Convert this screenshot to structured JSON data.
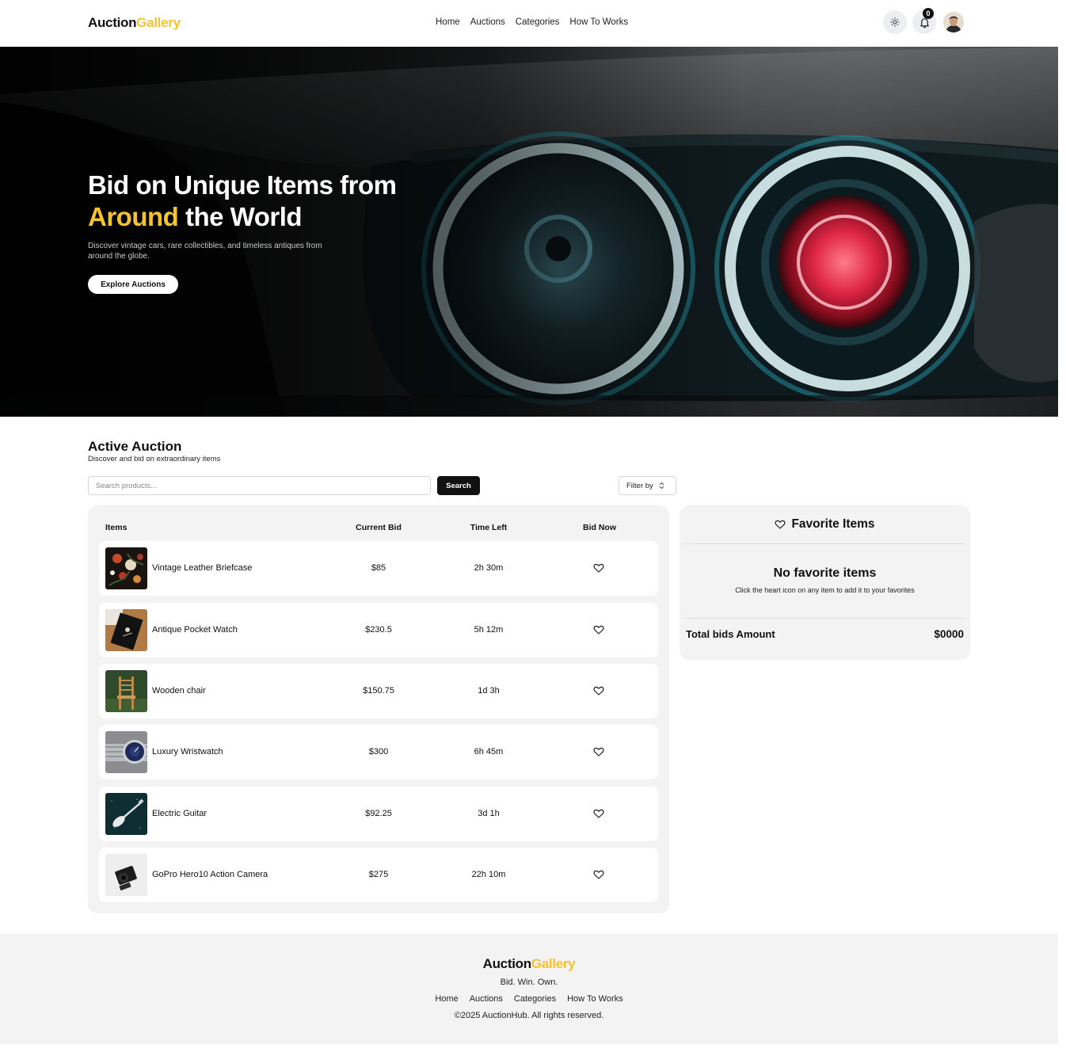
{
  "header": {
    "logo_part1": "Auction",
    "logo_part2": "Gallery",
    "nav": [
      "Home",
      "Auctions",
      "Categories",
      "How To Works"
    ],
    "notification_count": "0"
  },
  "hero": {
    "title_line1": "Bid on Unique Items from",
    "title_highlight": "Around",
    "title_line2_rest": " the World",
    "subtitle": "Discover vintage cars, rare collectibles, and timeless antiques from around the globe.",
    "cta_label": "Explore Auctions"
  },
  "auction": {
    "title": "Active Auction",
    "subtitle": "Discover and bid on extraordinary items",
    "search_placeholder": "Search products...",
    "search_label": "Search",
    "filter_label": "Filter by",
    "columns": {
      "items": "Items",
      "current_bid": "Current Bid",
      "time_left": "Time Left",
      "bid_now": "Bid Now"
    },
    "rows": [
      {
        "name": "Vintage Leather Briefcase",
        "bid": "$85",
        "time": "2h 30m",
        "thumb": "floral-painting"
      },
      {
        "name": "Antique Pocket Watch",
        "bid": "$230.5",
        "time": "5h 12m",
        "thumb": "pocket-watch-book"
      },
      {
        "name": "Wooden chair",
        "bid": "$150.75",
        "time": "1d 3h",
        "thumb": "wooden-chair"
      },
      {
        "name": "Luxury Wristwatch",
        "bid": "$300",
        "time": "6h 45m",
        "thumb": "wristwatch"
      },
      {
        "name": "Electric Guitar",
        "bid": "$92.25",
        "time": "3d 1h",
        "thumb": "electric-guitar"
      },
      {
        "name": "GoPro Hero10 Action Camera",
        "bid": "$275",
        "time": "22h 10m",
        "thumb": "camera"
      }
    ]
  },
  "favorites": {
    "title": "Favorite Items",
    "empty_title": "No favorite items",
    "empty_hint": "Click the heart icon on any item to add it to your favorites",
    "total_label": "Total bids Amount",
    "total_value": "$0000"
  },
  "footer": {
    "logo_part1": "Auction",
    "logo_part2": "Gallery",
    "tagline": "Bid. Win. Own.",
    "nav": [
      "Home",
      "Auctions",
      "Categories",
      "How To Works"
    ],
    "copyright": "©2025 AuctionHub. All rights reserved."
  },
  "colors": {
    "accent": "#f5c230",
    "dark": "#111111",
    "panel": "#f3f3f3"
  }
}
